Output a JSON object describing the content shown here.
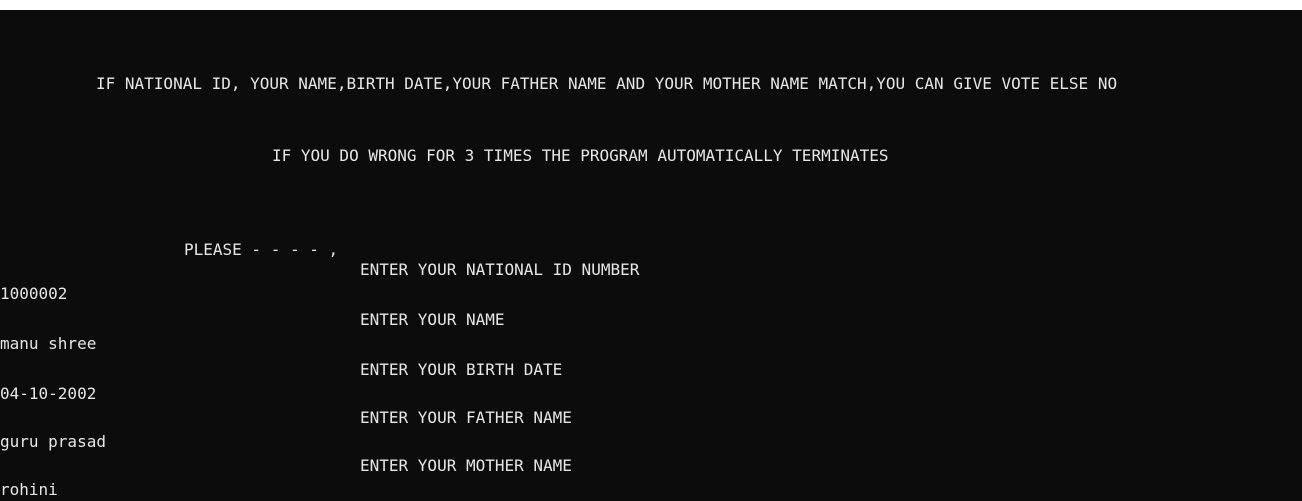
{
  "window": {
    "background": "#0c0c0c",
    "text_color": "#e6e6e6"
  },
  "console": {
    "rules_line": "IF NATIONAL ID, YOUR NAME,BIRTH DATE,YOUR FATHER NAME AND YOUR MOTHER NAME MATCH,YOU CAN GIVE VOTE ELSE NO",
    "warning_line": "IF YOU DO WRONG FOR 3 TIMES THE PROGRAM AUTOMATICALLY TERMINATES",
    "please_line": "PLEASE - - - - ,",
    "prompts": {
      "national_id": "ENTER YOUR NATIONAL ID NUMBER",
      "name": "ENTER YOUR NAME",
      "birth_date": "ENTER YOUR BIRTH DATE",
      "father_name": "ENTER YOUR FATHER NAME",
      "mother_name": "ENTER YOUR MOTHER NAME"
    },
    "inputs": {
      "national_id": "1000002",
      "name": "manu shree",
      "birth_date": "04-10-2002",
      "father_name": "guru prasad",
      "mother_name": "rohini"
    }
  }
}
